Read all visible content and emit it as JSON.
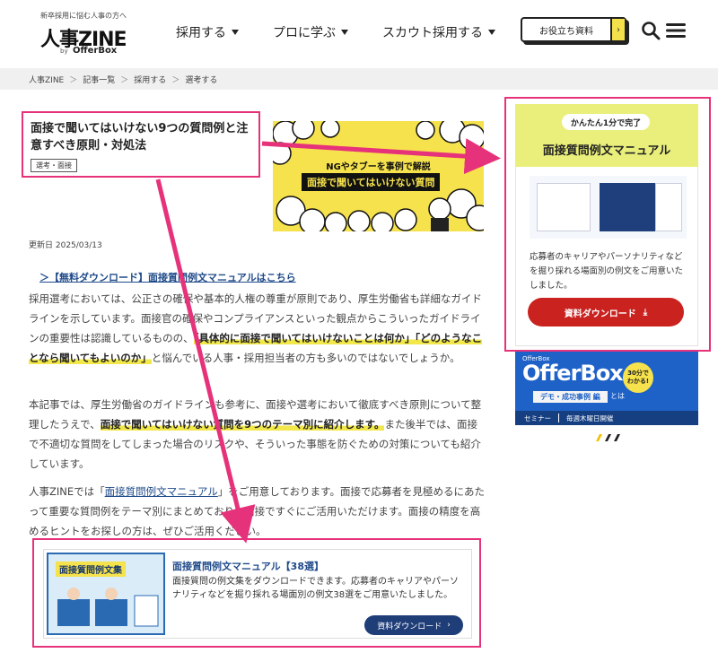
{
  "header": {
    "tagline": "新卒採用に悩む人事の方へ",
    "brand": "人事ZINE",
    "by": "by",
    "offerbox": "OfferBox",
    "nav": [
      {
        "label": "採用する"
      },
      {
        "label": "プロに学ぶ"
      },
      {
        "label": "スカウト採用する"
      }
    ],
    "useful_label": "お役立ち資料",
    "useful_arrow": "›"
  },
  "breadcrumb": [
    "人事ZINE",
    "記事一覧",
    "採用する",
    "選考する"
  ],
  "article": {
    "title": "面接で聞いてはいけない9つの質問例と注意すべき原則・対処法",
    "tag": "選考・面接",
    "hero_caption_1": "NGやタブーを事例で解説",
    "hero_caption_2": "面接で聞いてはいけない質問",
    "date": "更新日 2025/03/13",
    "download_link": "＞【無料ダウンロード】面接質問例文マニュアルはこちら",
    "p1_a": "採用選考においては、公正さの確保や基本的人権の尊重が原則であり、厚生労働省も詳細なガイドラインを示しています。面接官の確保やコンプライアンスといった観点からこういったガイドラインの重要性は認識しているものの、",
    "p1_hl": "「具体的に面接で聞いてはいけないことは何か」「どのようなことなら聞いてもよいのか」",
    "p1_b": "と悩んでいる人事・採用担当者の方も多いのではないでしょうか。",
    "p2_a": "本記事では、厚生労働省のガイドラインも参考に、面接や選考において徹底すべき原則について整理したうえで、",
    "p2_hl": "面接で聞いてはいけない質問を9つのテーマ別に紹介します。",
    "p2_b": "また後半では、面接で不適切な質問をしてしまった場合のリスクや、そういった事態を防ぐための対策についても紹介しています。",
    "p3_a": "人事ZINEでは「",
    "p3_link": "面接質問例文マニュアル",
    "p3_b": "」をご用意しております。面接で応募者を見極めるにあたって重要な質問例をテーマ別にまとめており、面接ですぐにご活用いただけます。面接の精度を高めるヒントをお探しの方は、ぜひご活用ください。"
  },
  "card": {
    "thumb_title": "面接質問例文集",
    "title": "面接質問例文マニュアル【38選】",
    "desc": "面接質問の例文集をダウンロードできます。応募者のキャリアやパーソナリティなどを掘り採れる場面別の例文38選をご用意いたしました。",
    "button": "資料ダウンロード",
    "button_icon": "›"
  },
  "sidebar": {
    "pill": "かんたん1分で完了",
    "title": "面接質問例文マニュアル",
    "desc": "応募者のキャリアやパーソナリティなどを掘り採れる場面別の例文をご用意いたしました。",
    "button": "資料ダウンロード",
    "button_icon": "⤓"
  },
  "banner": {
    "logo": "OfferBox",
    "title": "OfferBox",
    "badge": "30分で\nわかる!",
    "sub": "デモ・成功事例 編",
    "to": "とは",
    "foot_left": "セミナー",
    "foot_right": "毎週木曜日開催"
  },
  "colors": {
    "accent_pink": "#e6327a",
    "link_blue": "#1f4a8a",
    "highlight_yellow": "#f2e84a",
    "cta_red": "#c9221f"
  }
}
